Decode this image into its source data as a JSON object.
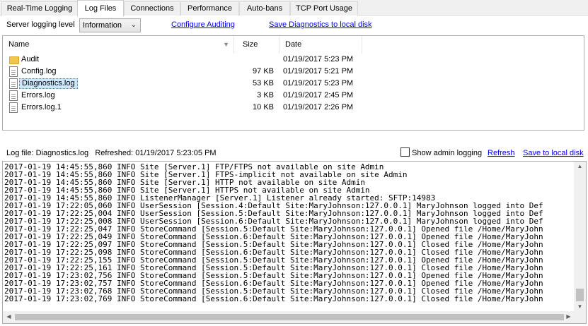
{
  "tabs": [
    {
      "label": "Real-Time Logging"
    },
    {
      "label": "Log Files"
    },
    {
      "label": "Connections"
    },
    {
      "label": "Performance"
    },
    {
      "label": "Auto-bans"
    },
    {
      "label": "TCP Port Usage"
    }
  ],
  "active_tab": "Log Files",
  "controls": {
    "server_logging_level_label": "Server logging level",
    "level_value": "Information",
    "configure_auditing": "Configure Auditing",
    "save_diagnostics": "Save Diagnostics to local disk"
  },
  "file_list": {
    "columns": {
      "name": "Name",
      "size": "Size",
      "date": "Date"
    },
    "rows": [
      {
        "name": "Audit",
        "size": "",
        "date": "01/19/2017 5:23 PM",
        "type": "folder"
      },
      {
        "name": "Config.log",
        "size": "97 KB",
        "date": "01/19/2017 5:21 PM",
        "type": "file"
      },
      {
        "name": "Diagnostics.log",
        "size": "53 KB",
        "date": "01/19/2017 5:23 PM",
        "type": "file",
        "selected": true
      },
      {
        "name": "Errors.log",
        "size": "3 KB",
        "date": "01/19/2017 2:45 PM",
        "type": "file"
      },
      {
        "name": "Errors.log.1",
        "size": "10 KB",
        "date": "01/19/2017 2:26 PM",
        "type": "file"
      }
    ]
  },
  "status": {
    "log_file": "Log file: Diagnostics.log",
    "refreshed": "Refreshed: 01/19/2017 5:23:05 PM",
    "show_admin_logging": "Show admin logging",
    "refresh": "Refresh",
    "save_to_local": "Save to local disk"
  },
  "log_lines": [
    "2017-01-19 14:45:55,860 INFO Site [Server.1] FTP/FTPS not available on site Admin",
    "2017-01-19 14:45:55,860 INFO Site [Server.1] FTPS-implicit not available on site Admin",
    "2017-01-19 14:45:55,860 INFO Site [Server.1] HTTP not available on site Admin",
    "2017-01-19 14:45:55,860 INFO Site [Server.1] HTTPS not available on site Admin",
    "2017-01-19 14:45:55,860 INFO ListenerManager [Server.1] Listener already started: SFTP:14983",
    "2017-01-19 17:22:05,060 INFO UserSession [Session.4:Default Site:MaryJohnson:127.0.0.1] MaryJohnson logged into Def",
    "2017-01-19 17:22:25,004 INFO UserSession [Session.5:Default Site:MaryJohnson:127.0.0.1] MaryJohnson logged into Def",
    "2017-01-19 17:22:25,008 INFO UserSession [Session.6:Default Site:MaryJohnson:127.0.0.1] MaryJohnson logged into Def",
    "2017-01-19 17:22:25,047 INFO StoreCommand [Session.5:Default Site:MaryJohnson:127.0.0.1] Opened file /Home/MaryJohn",
    "2017-01-19 17:22:25,049 INFO StoreCommand [Session.6:Default Site:MaryJohnson:127.0.0.1] Opened file /Home/MaryJohn",
    "2017-01-19 17:22:25,097 INFO StoreCommand [Session.5:Default Site:MaryJohnson:127.0.0.1] Closed file /Home/MaryJohn",
    "2017-01-19 17:22:25,098 INFO StoreCommand [Session.6:Default Site:MaryJohnson:127.0.0.1] Closed file /Home/MaryJohn",
    "2017-01-19 17:22:25,155 INFO StoreCommand [Session.5:Default Site:MaryJohnson:127.0.0.1] Opened file /Home/MaryJohn",
    "2017-01-19 17:22:25,161 INFO StoreCommand [Session.5:Default Site:MaryJohnson:127.0.0.1] Closed file /Home/MaryJohn",
    "2017-01-19 17:23:02,756 INFO StoreCommand [Session.5:Default Site:MaryJohnson:127.0.0.1] Opened file /Home/MaryJohn",
    "2017-01-19 17:23:02,757 INFO StoreCommand [Session.6:Default Site:MaryJohnson:127.0.0.1] Opened file /Home/MaryJohn",
    "2017-01-19 17:23:02,768 INFO StoreCommand [Session.5:Default Site:MaryJohnson:127.0.0.1] Closed file /Home/MaryJohn",
    "2017-01-19 17:23:02,769 INFO StoreCommand [Session.6:Default Site:MaryJohnson:127.0.0.1] Closed file /Home/MaryJohn"
  ]
}
